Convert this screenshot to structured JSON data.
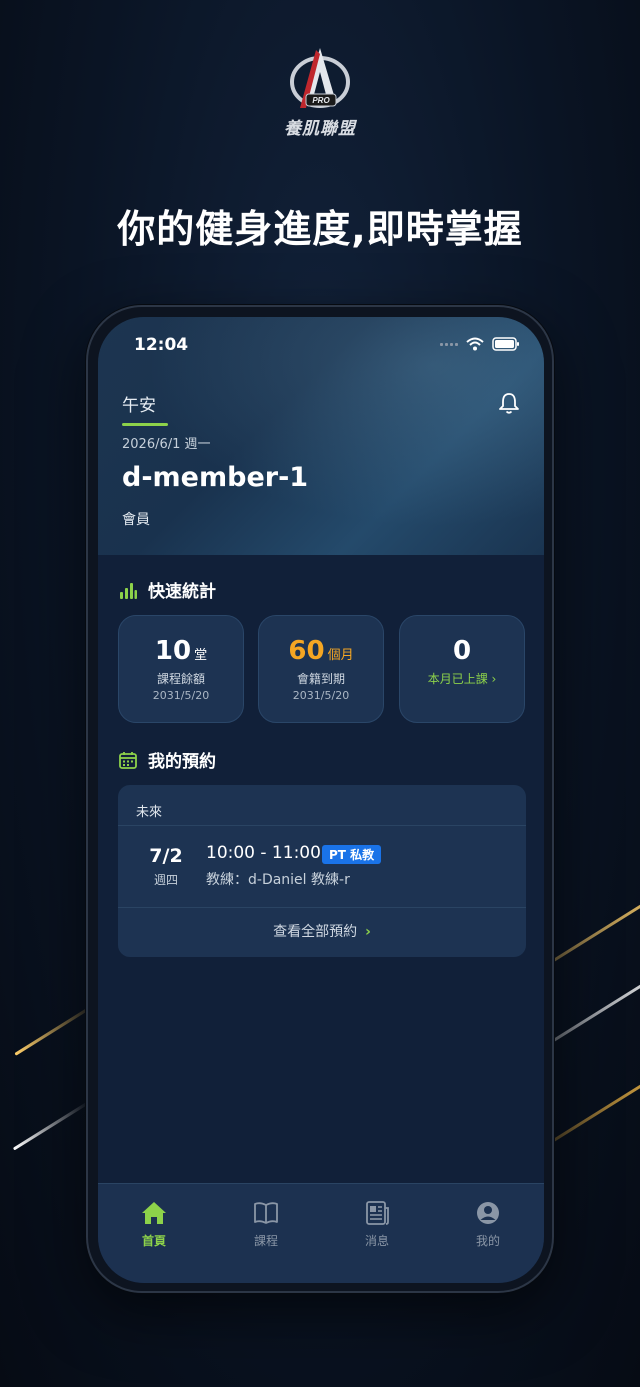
{
  "promo": {
    "logo_mark": "PRO",
    "logo_text": "養肌聯盟",
    "headline": "你的健身進度,即時掌握"
  },
  "status_bar": {
    "time": "12:04"
  },
  "header": {
    "greeting": "午安",
    "date": "2026/6/1 週一",
    "username": "d-member-1",
    "role": "會員"
  },
  "quick_stats": {
    "title": "快速統計",
    "cards": [
      {
        "value": "10",
        "unit": "堂",
        "label": "課程餘額",
        "sub": "2031/5/20"
      },
      {
        "value": "60",
        "unit": "個月",
        "label": "會籍到期",
        "sub": "2031/5/20"
      },
      {
        "value": "0",
        "label": "本月已上課 ›"
      }
    ]
  },
  "bookings": {
    "title": "我的預約",
    "section_label": "未來",
    "items": [
      {
        "date": "7/2",
        "weekday": "週四",
        "time": "10:00 - 11:00",
        "tag": "PT 私教",
        "coach": "教練：d-Daniel 教練-r"
      }
    ],
    "view_all": "查看全部預約"
  },
  "tabbar": {
    "items": [
      {
        "label": "首頁",
        "icon": "home-icon",
        "active": true
      },
      {
        "label": "課程",
        "icon": "book-icon",
        "active": false
      },
      {
        "label": "消息",
        "icon": "news-icon",
        "active": false
      },
      {
        "label": "我的",
        "icon": "profile-icon",
        "active": false
      }
    ]
  },
  "colors": {
    "accent_green": "#8dd24a",
    "accent_orange": "#f5a623",
    "tag_blue": "#1a73e8",
    "card_bg": "#1d3352",
    "screen_bg": "#112039"
  }
}
